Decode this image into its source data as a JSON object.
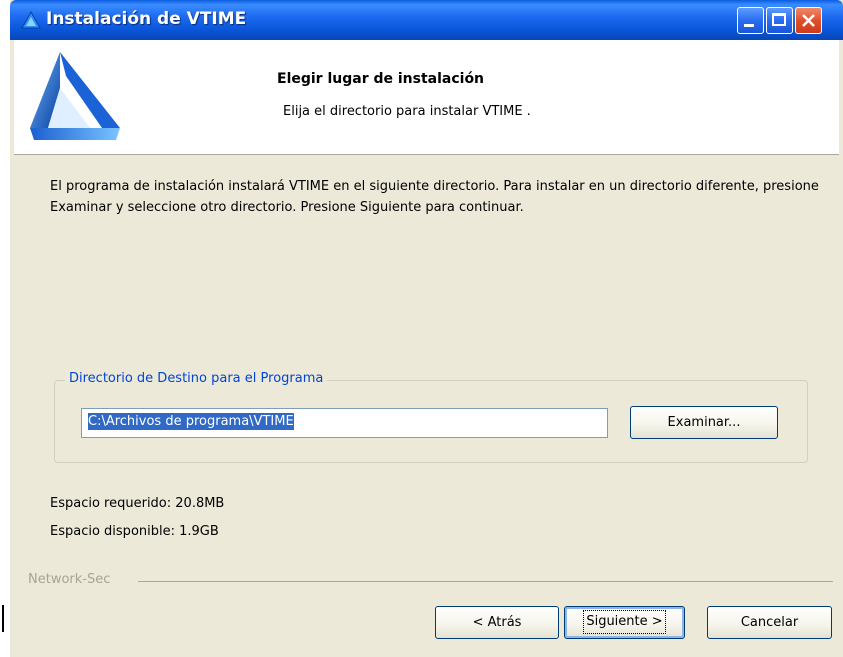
{
  "window": {
    "title": "Instalación de VTIME"
  },
  "header": {
    "title": "Elegir lugar de instalación",
    "subtitle": "Elija el directorio para instalar VTIME ."
  },
  "main": {
    "description": "El programa de instalación instalará VTIME  en el siguiente directorio. Para instalar en un directorio diferente, presione Examinar y seleccione otro directorio. Presione Siguiente para continuar.",
    "group_label": "Directorio de Destino para el Programa",
    "path_value": "C:\\Archivos de programa\\VTIME",
    "browse_label": "Examinar...",
    "space_required": "Espacio requerido: 20.8MB",
    "space_available": "Espacio disponible: 1.9GB"
  },
  "footer": {
    "brand": "Network-Sec",
    "back_label": "< Atrás",
    "next_label": "Siguiente >",
    "cancel_label": "Cancelar"
  },
  "icons": {
    "app": "vtime-triangle-logo",
    "minimize": "minimize-icon",
    "maximize": "maximize-icon",
    "close": "close-icon"
  },
  "colors": {
    "titlebar": "#0a55d8",
    "window_bg": "#ece9d8",
    "selection": "#316ac5",
    "group_label": "#0046d5"
  }
}
